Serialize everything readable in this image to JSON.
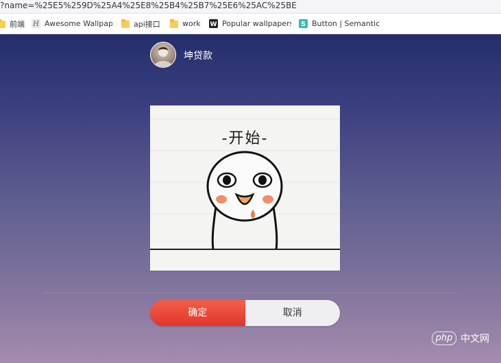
{
  "browser": {
    "url_text": "?name=%25E5%259D%25A4%25E8%25B4%25B7%25E6%25AC%25BE",
    "bookmarks": [
      {
        "label": "前端",
        "icon": "folder-icon"
      },
      {
        "label": "Awesome Wallpape",
        "icon": "awesome-wallpaper-favicon"
      },
      {
        "label": "api接口",
        "icon": "folder-icon"
      },
      {
        "label": "work",
        "icon": "folder-icon"
      },
      {
        "label": "Popular wallpapers",
        "icon": "w-favicon"
      },
      {
        "label": "Button | Semantic U",
        "icon": "semantic-ui-favicon"
      }
    ]
  },
  "profile": {
    "username": "坤贷款"
  },
  "image": {
    "caption": "-开始-"
  },
  "actions": {
    "confirm_label": "确定",
    "cancel_label": "取消"
  },
  "watermark": {
    "logo_text": "php",
    "site_text": "中文网"
  },
  "colors": {
    "confirm_button": "#e8412f",
    "cancel_button": "#efeff1",
    "background_top": "#242e6b",
    "background_bottom": "#a48cae"
  }
}
